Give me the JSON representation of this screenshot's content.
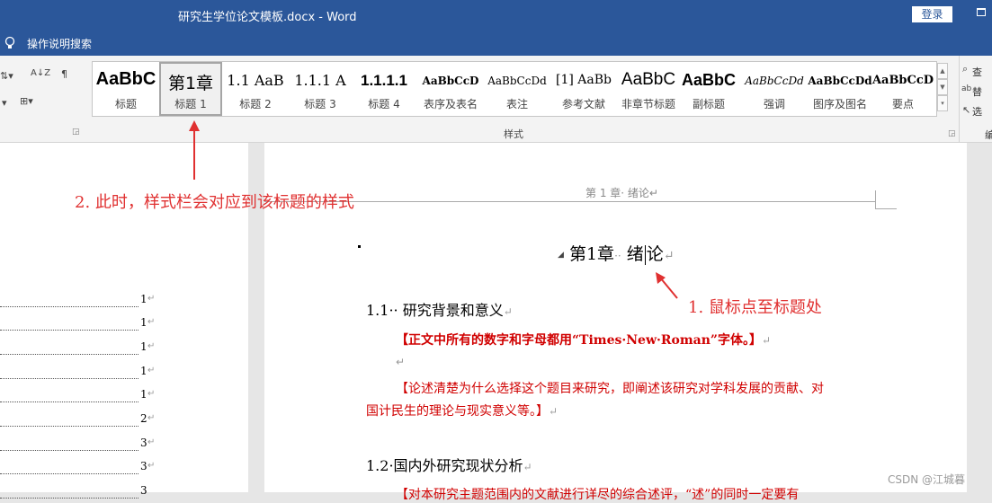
{
  "window": {
    "title": "研究生学位论文模板.docx  -  Word",
    "login_label": "登录"
  },
  "tellme": {
    "label": "操作说明搜索"
  },
  "ribbon": {
    "group_label": "样式",
    "styles": [
      {
        "preview": "AaBbC",
        "name": "标题",
        "selected": false
      },
      {
        "preview": "第1章",
        "name": "标题 1",
        "selected": true
      },
      {
        "preview": "1.1  AaB",
        "name": "标题 2",
        "selected": false
      },
      {
        "preview": "1.1.1  A",
        "name": "标题 3",
        "selected": false
      },
      {
        "preview": "1.1.1.1",
        "name": "标题 4",
        "selected": false
      },
      {
        "preview": "AaBbCcD",
        "name": "表序及表名",
        "selected": false
      },
      {
        "preview": "AaBbCcDd",
        "name": "表注",
        "selected": false
      },
      {
        "preview": "[1]  AaBb",
        "name": "参考文献",
        "selected": false
      },
      {
        "preview": "AaBbC",
        "name": "非章节标题",
        "selected": false
      },
      {
        "preview": "AaBbCc",
        "name": "副标题",
        "selected": false
      },
      {
        "preview": "AaBbCcDd",
        "name": "强调",
        "selected": false
      },
      {
        "preview": "AaBbCcDd",
        "name": "图序及图名",
        "selected": false
      },
      {
        "preview": "AaBbCcD",
        "name": "要点",
        "selected": false
      }
    ],
    "right_group": [
      "查",
      "替",
      "选",
      "编"
    ]
  },
  "nav": {
    "toc_pages": [
      "1",
      "1",
      "1",
      "1",
      "1",
      "2",
      "3",
      "3",
      "3"
    ]
  },
  "document": {
    "header": "第 1 章· 绪论↵",
    "heading1": {
      "num": "第1章",
      "sep": "··",
      "text_a": "绪",
      "text_b": "论",
      "mark": "↵"
    },
    "section1": {
      "title": "1.1·· 研究背景和意义",
      "mark": "↵"
    },
    "note1": {
      "text": "【正文中所有的数字和字母都用“Times·New·Roman”字体。】",
      "mark": "↵"
    },
    "empty_mark": "↵",
    "para1": "【论述清楚为什么选择这个题目来研究，即阐述该研究对学科发展的贡献、对",
    "para1b": "国计民生的理论与现实意义等。】",
    "para1b_mark": "↵",
    "section2": {
      "title": "1.2·国内外研究现状分析",
      "mark": "↵"
    },
    "para2": "【对本研究主题范围内的文献进行详尽的综合述评，“述”的同时一定要有"
  },
  "annotations": {
    "a1": "1. 鼠标点至标题处",
    "a2": "2. 此时，样式栏会对应到该标题的样式",
    "color": "#e03030"
  },
  "watermark": "CSDN @江城暮"
}
